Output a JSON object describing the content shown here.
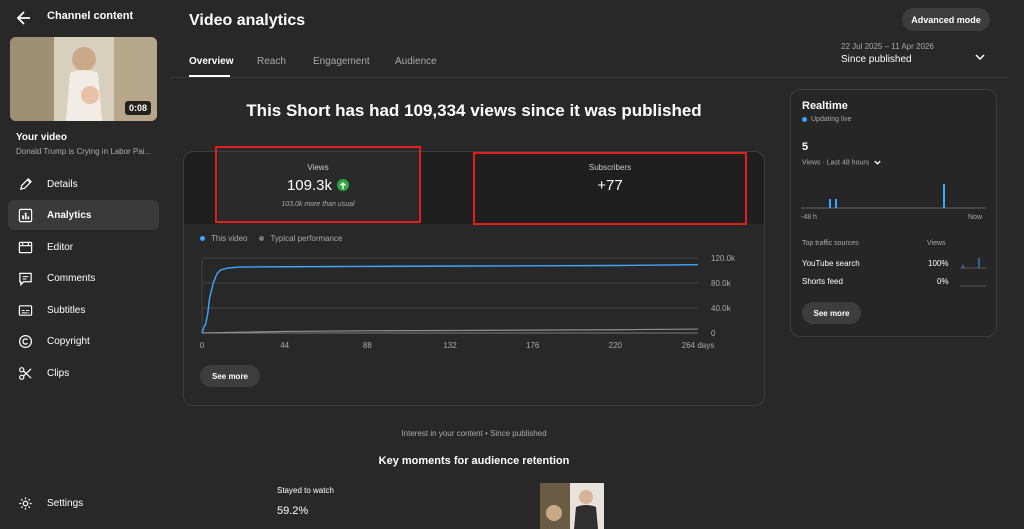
{
  "sidebar": {
    "title": "Channel content",
    "thumbnail_duration": "0:08",
    "your_video_label": "Your video",
    "video_title": "Donald Trump is Crying in Labor Pai...",
    "nav": [
      {
        "label": "Details",
        "icon": "pencil-icon"
      },
      {
        "label": "Analytics",
        "icon": "bar-chart-icon",
        "active": true
      },
      {
        "label": "Editor",
        "icon": "film-icon"
      },
      {
        "label": "Comments",
        "icon": "comment-icon"
      },
      {
        "label": "Subtitles",
        "icon": "subtitles-icon"
      },
      {
        "label": "Copyright",
        "icon": "copyright-icon"
      },
      {
        "label": "Clips",
        "icon": "scissors-icon"
      }
    ],
    "settings_label": "Settings"
  },
  "header": {
    "title": "Video analytics",
    "advanced_mode_label": "Advanced mode",
    "tabs": [
      {
        "label": "Overview",
        "active": true
      },
      {
        "label": "Reach"
      },
      {
        "label": "Engagement"
      },
      {
        "label": "Audience"
      }
    ],
    "date_range": "22 Jul 2025 – 11 Apr 2026",
    "date_selection": "Since published"
  },
  "headline": "This Short has had 109,334 views since it was published",
  "metrics": {
    "views": {
      "label": "Views",
      "value": "109.3k",
      "note": "103.0k more than usual"
    },
    "subscribers": {
      "label": "Subscribers",
      "value": "+77"
    }
  },
  "chart_data": {
    "type": "line",
    "legend": [
      "This video",
      "Typical performance"
    ],
    "x_ticks": [
      "0",
      "44",
      "88",
      "132",
      "176",
      "220",
      "264 days"
    ],
    "y_ticks": [
      "120.0k",
      "80.0k",
      "40.0k",
      "0"
    ],
    "ylim": [
      0,
      120000
    ],
    "xlim": [
      0,
      264
    ],
    "series": [
      {
        "name": "This video",
        "color": "#3ea6ff",
        "x": [
          0,
          1,
          2,
          3,
          4,
          6,
          8,
          10,
          14,
          20,
          44,
          88,
          132,
          176,
          220,
          264
        ],
        "y": [
          0,
          9000,
          15000,
          30000,
          55000,
          80000,
          95000,
          101000,
          104000,
          105500,
          106000,
          106500,
          107000,
          107500,
          108000,
          109334
        ]
      },
      {
        "name": "Typical performance",
        "color": "#909090",
        "x": [
          0,
          44,
          88,
          132,
          176,
          220,
          264
        ],
        "y": [
          0,
          2500,
          3500,
          4000,
          4600,
          5200,
          6300
        ]
      }
    ]
  },
  "see_more_label": "See more",
  "realtime": {
    "title": "Realtime",
    "status": "Updating live",
    "value": "5",
    "subtitle": "Views · Last 48 hours",
    "axis_start": "-48 h",
    "axis_end": "Now",
    "traffic_header": "Top traffic sources",
    "traffic_col": "Views",
    "sources": [
      {
        "name": "YouTube search",
        "value": "100%"
      },
      {
        "name": "Shorts feed",
        "value": "0%"
      }
    ],
    "see_more_label": "See more"
  },
  "bottom": {
    "interest": "Interest in your content • Since published",
    "key_moments": "Key moments for audience retention",
    "stayed_label": "Stayed to watch",
    "stayed_value": "59.2%"
  }
}
